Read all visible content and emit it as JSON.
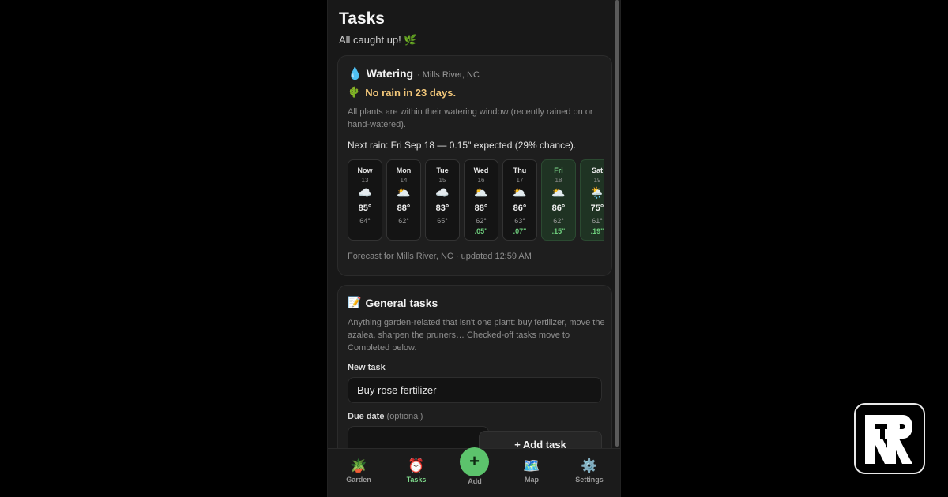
{
  "page": {
    "title": "Tasks",
    "subtitle": "All caught up! 🌿"
  },
  "watering": {
    "icon": "droplet-icon",
    "icon_glyph": "💧",
    "title": "Watering",
    "location": "· Mills River, NC",
    "alert_icon": "cactus-icon",
    "alert_glyph": "🌵",
    "alert": "No rain in 23 days.",
    "description": "All plants are within their watering window (recently rained on or hand-watered).",
    "next_rain": "Next rain: Fri Sep 18 — 0.15\" expected (29% chance).",
    "forecast": [
      {
        "name": "Now",
        "date": "13",
        "icon": "cloudy-icon",
        "glyph": "☁️",
        "high": "85°",
        "low": "64°",
        "precip": "",
        "rainy": false
      },
      {
        "name": "Mon",
        "date": "14",
        "icon": "partly-cloudy-icon",
        "glyph": "🌥️",
        "high": "88°",
        "low": "62°",
        "precip": "",
        "rainy": false
      },
      {
        "name": "Tue",
        "date": "15",
        "icon": "cloudy-icon",
        "glyph": "☁️",
        "high": "83°",
        "low": "65°",
        "precip": "",
        "rainy": false
      },
      {
        "name": "Wed",
        "date": "16",
        "icon": "partly-cloudy-icon",
        "glyph": "🌥️",
        "high": "88°",
        "low": "62°",
        "precip": ".05\"",
        "rainy": false
      },
      {
        "name": "Thu",
        "date": "17",
        "icon": "partly-cloudy-icon",
        "glyph": "🌥️",
        "high": "86°",
        "low": "63°",
        "precip": ".07\"",
        "rainy": false
      },
      {
        "name": "Fri",
        "date": "18",
        "icon": "partly-cloudy-icon",
        "glyph": "🌥️",
        "high": "86°",
        "low": "62°",
        "precip": ".15\"",
        "rainy": true
      },
      {
        "name": "Sat",
        "date": "19",
        "icon": "rain-cloud-icon",
        "glyph": "🌦️",
        "high": "75°",
        "low": "61°",
        "precip": ".19\"",
        "rainy": true
      }
    ],
    "forecast_note": "Forecast for Mills River, NC · updated 12:59 AM"
  },
  "general": {
    "icon": "memo-icon",
    "icon_glyph": "📝",
    "title": "General tasks",
    "description": "Anything garden-related that isn't one plant: buy fertilizer, move the azalea, sharpen the pruners… Checked-off tasks move to Completed below.",
    "new_task_label": "New task",
    "new_task_value": "Buy rose fertilizer",
    "due_date_label": "Due date",
    "due_date_optional": "(optional)",
    "add_button": "+ Add task"
  },
  "tabbar": {
    "tabs": [
      {
        "label": "Garden",
        "icon": "potted-plant-icon",
        "glyph": "🪴",
        "active": false
      },
      {
        "label": "Tasks",
        "icon": "alarm-clock-icon",
        "glyph": "⏰",
        "active": true
      },
      {
        "label": "Map",
        "icon": "map-icon",
        "glyph": "🗺️",
        "active": false
      },
      {
        "label": "Settings",
        "icon": "gear-icon",
        "glyph": "⚙️",
        "active": false
      }
    ],
    "add_glyph": "+",
    "add_label": "Add"
  },
  "colors": {
    "accent": "#5cc36c",
    "alert": "#f2c77a",
    "background": "#181818"
  },
  "logo": {
    "icon": "rr-logo-icon"
  }
}
